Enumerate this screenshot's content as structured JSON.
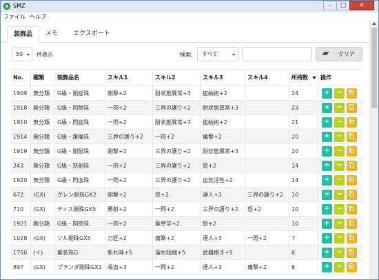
{
  "window": {
    "title": "SMZ",
    "controls": [
      "–",
      "□",
      "✕"
    ]
  },
  "menu": [
    "ファイル",
    "ヘルプ"
  ],
  "tabs": [
    "装飾品",
    "メモ",
    "エクスポート"
  ],
  "toolbar": {
    "per_page_value": "50",
    "per_page_suffix": "件表示",
    "search_label": "検索:",
    "search_field_value": "すべて",
    "search_input_value": "",
    "clear_label": "クリア"
  },
  "table": {
    "headers": [
      "No.",
      "種類",
      "装飾品名",
      "スキル1",
      "スキル2",
      "スキル3",
      "スキル4",
      "所持数",
      "操作"
    ],
    "sorted_column": "所持数",
    "sort_direction": "desc",
    "rows": [
      [
        "1909",
        "無分類",
        "G級・剛抜珠",
        "剛撃+2",
        "耐状態異常+3",
        "抜納術+2",
        "",
        "24"
      ],
      [
        "1918",
        "無分類",
        "G級・閃耐珠",
        "一閃+2",
        "三界の護り+2",
        "耐状態異常+3",
        "",
        "23"
      ],
      [
        "1910",
        "無分類",
        "G級・閃抜珠",
        "一閃+2",
        "耐状態異常+3",
        "抜納術+2",
        "",
        "21"
      ],
      [
        "1914",
        "無分類",
        "G級・護痛珠",
        "三界の護り+2",
        "一閃+2",
        "痛撃+2",
        "",
        "20"
      ],
      [
        "1919",
        "無分類",
        "G級・剛耐珠",
        "剛撃+2",
        "三界の護り+2",
        "耐状態異常+3",
        "",
        "20"
      ],
      [
        "243",
        "無分類",
        "G級・怒剛珠",
        "一閃+2",
        "三界の護り+2",
        "怒+2",
        "",
        "14"
      ],
      [
        "1920",
        "無分類",
        "G級・閃血珠",
        "一閃+2",
        "三界の護り+2",
        "血気活性+2",
        "",
        "14"
      ],
      [
        "672",
        "(GX)",
        "グレン剛珠GX2",
        "剛撃+2",
        "怒+2",
        "達人+3",
        "三界の護り+2",
        "10"
      ],
      [
        "710",
        "(GX)",
        "ディス剛珠GX5",
        "悪射+2",
        "一閃+2",
        "三界の護り+2",
        "怒+2",
        "10"
      ],
      [
        "1921",
        "無分類",
        "G級・閃怒珠",
        "一閃+2",
        "薬草学+2",
        "怒+2",
        "",
        "10"
      ],
      [
        "1028",
        "(GX)",
        "ソル剛珠GX5",
        "刀匠+2",
        "痛撃+2",
        "達人+3",
        "一閃+2",
        "7"
      ],
      [
        "1750",
        "(イ)",
        "集装珠G",
        "斬れ味+5",
        "溜め短縮+5",
        "武器捌き+5",
        "",
        "6"
      ],
      [
        "897",
        "(GX)",
        "ブランダ剛珠GX1",
        "吸血+3",
        "一閃+2",
        "達人+3",
        "痛撃+2",
        "6"
      ]
    ]
  },
  "colors": {
    "plus_button": "#1fbfa8",
    "minus_button": "#bcd11f",
    "copy_button": "#f2b50c",
    "title_bar": "#dde8f4",
    "close_button": "#c9463d"
  },
  "icons": {
    "app": "app-icon",
    "clear": "eraser-icon",
    "row_actions": [
      "plus-icon",
      "minus-icon",
      "copy-icon"
    ]
  }
}
